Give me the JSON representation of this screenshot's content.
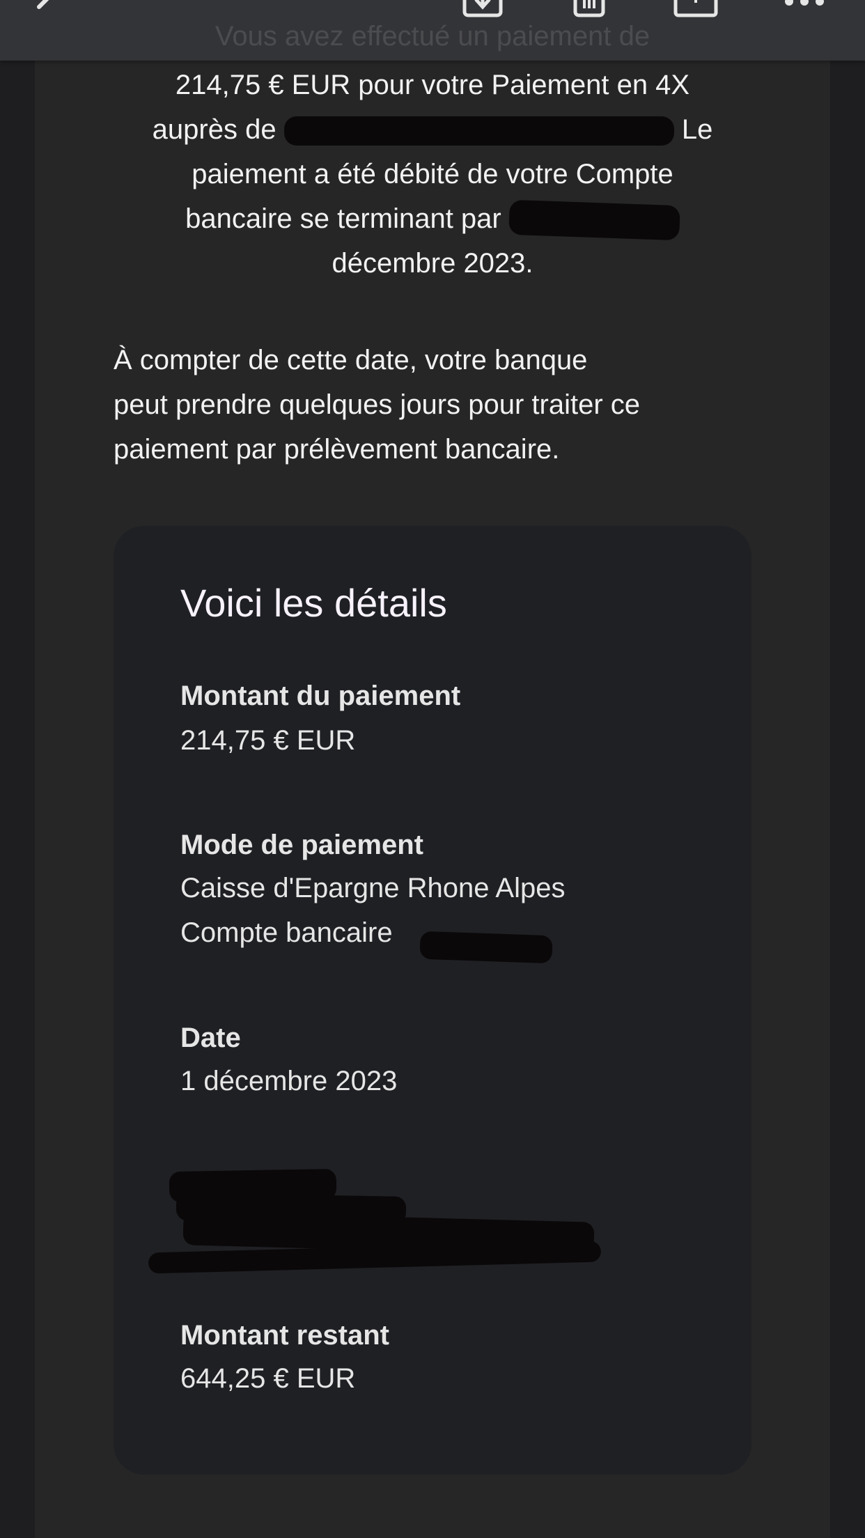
{
  "header": {
    "back_icon": "chevron-left-icon",
    "icons": [
      "archive-icon",
      "trash-icon",
      "move-icon",
      "more-icon"
    ],
    "faded_text": "Vous avez effectué un paiement de"
  },
  "intro": {
    "line1": "214,75 € EUR pour votre Paiement en 4X",
    "line2_start": "auprès de ",
    "line2_end": " Le",
    "line3": "paiement a été débité de votre Compte",
    "line4_start": "bancaire se terminant par ",
    "line5": "décembre 2023."
  },
  "notice": {
    "line1": "À compter de cette date, votre banque",
    "line2": "peut prendre quelques jours pour traiter ce",
    "line3": "paiement par prélèvement bancaire."
  },
  "details": {
    "title": "Voici les détails",
    "amount_label": "Montant du paiement",
    "amount_value": "214,75 € EUR",
    "method_label": "Mode de paiement",
    "method_bank": "Caisse d'Epargne Rhone Alpes",
    "method_account": "Compte bancaire ",
    "date_label": "Date",
    "date_value": "1 décembre 2023",
    "remaining_label": "Montant restant",
    "remaining_value": "644,25 € EUR"
  }
}
